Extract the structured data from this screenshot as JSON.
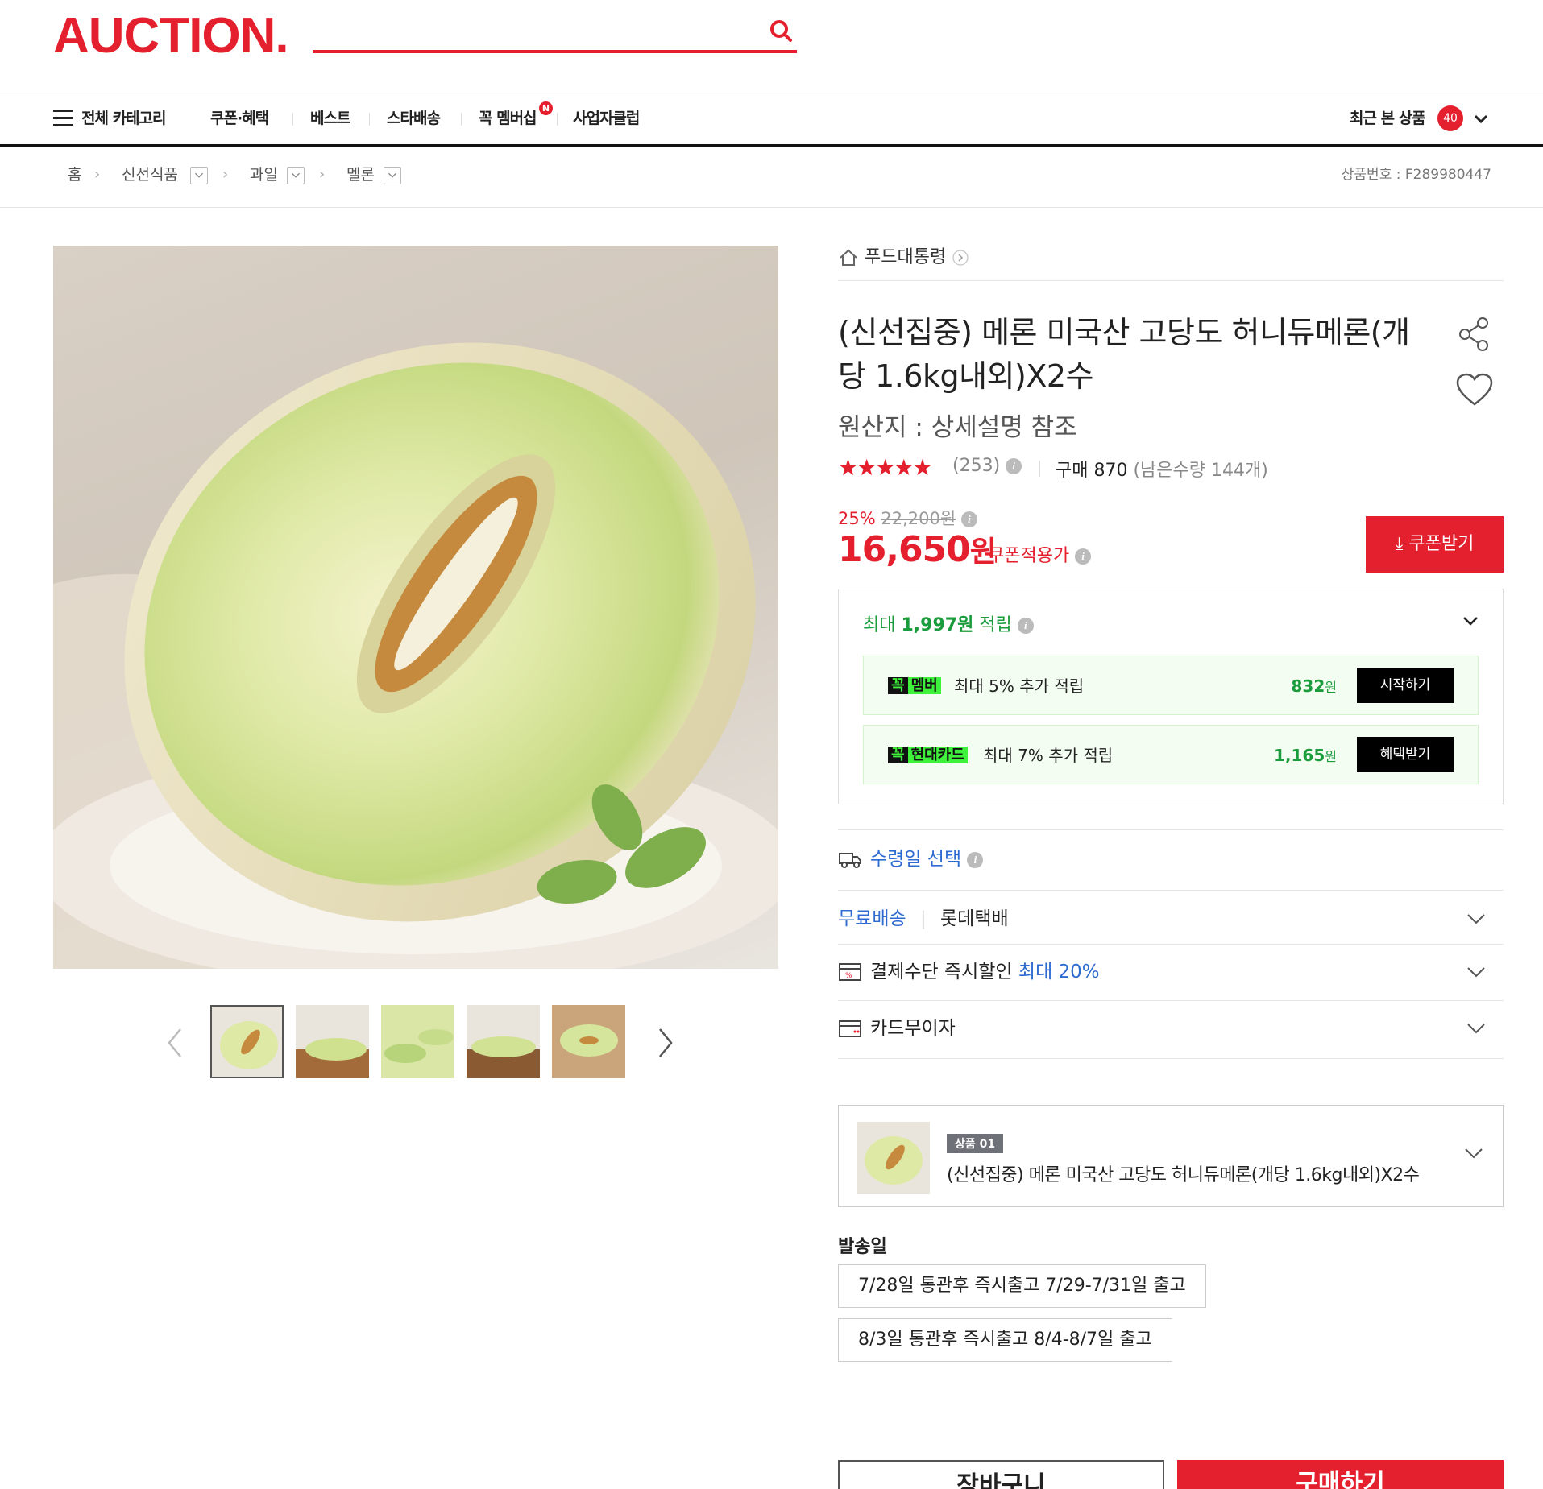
{
  "header": {
    "logo": "AUCTION.",
    "search_placeholder": ""
  },
  "gnb": {
    "all_category": "전체 카테고리",
    "menu": [
      "쿠폰·혜택",
      "베스트",
      "스타배송",
      "꼭 멤버십",
      "사업자클럽"
    ],
    "new_badge": "N",
    "recent_label": "최근 본 상품",
    "recent_count": "40"
  },
  "breadcrumb": {
    "items": [
      "홈",
      "신선식품",
      "과일",
      "멜론"
    ],
    "product_no": "상품번호 : F289980447"
  },
  "product": {
    "store": "푸드대통령",
    "title": "(신선집중) 메론 미국산 고당도 허니듀메론(개당 1.6kg내외)X2수",
    "origin": "원산지 : 상세설명 참조",
    "stars": "★★★★★",
    "rating_count": "(253)",
    "buy_label": "구매 870",
    "remaining": "(남은수량 144개)",
    "discount_rate": "25%",
    "original_price": "22,200원",
    "price_number": "16,650",
    "price_unit": "원",
    "coupon_applied": "쿠폰적용가",
    "coupon_button": "⤓ 쿠폰받기"
  },
  "points": {
    "prefix": "최대 ",
    "amount": "1,997원",
    "suffix": " 적립",
    "rows": [
      {
        "badge_k": "꼭",
        "badge_name": "멤버",
        "text": "최대 5% 추가 적립",
        "amount": "832",
        "unit": "원",
        "button": "시작하기"
      },
      {
        "badge_k": "꼭",
        "badge_name": "현대카드",
        "text": "최대 7% 추가 적립",
        "amount": "1,165",
        "unit": "원",
        "button": "혜택받기"
      }
    ]
  },
  "options": {
    "receive_date": "수령일 선택",
    "free_shipping": "무료배송",
    "courier": "롯데택배",
    "payment_discount": "결제수단 즉시할인",
    "payment_discount_max": "최대 20%",
    "card_interest_free": "카드무이자"
  },
  "selection": {
    "tag": "상품 01",
    "name": "(신선집중) 메론 미국산 고당도 허니듀메론(개당 1.6kg내외)X2수"
  },
  "shipping": {
    "label": "발송일",
    "options": [
      "7/28일 통관후 즉시출고 7/29-7/31일 출고",
      "8/3일 통관후 즉시출고 8/4-8/7일 출고"
    ]
  },
  "actions": {
    "cart": "장바구니",
    "buy": "구매하기"
  },
  "colors": {
    "brand": "#e5202e",
    "point_green": "#1a9c3c",
    "link_blue": "#2e6bd1"
  },
  "icons": [
    "search-icon",
    "hamburger-icon",
    "chevron-down-icon",
    "home-icon",
    "share-icon",
    "heart-icon",
    "info-icon",
    "truck-icon",
    "payment-icon",
    "card-icon",
    "chevron-left-icon",
    "chevron-right-icon"
  ]
}
